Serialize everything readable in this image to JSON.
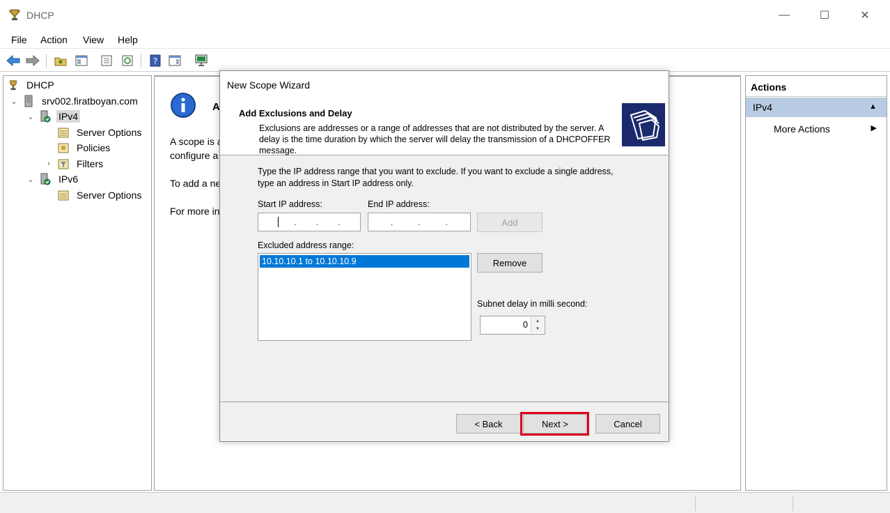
{
  "window": {
    "title": "DHCP",
    "minimize": "—",
    "maximize": "☐",
    "close": "✕"
  },
  "menu": [
    "File",
    "Action",
    "View",
    "Help"
  ],
  "tree": {
    "root": "DHCP",
    "server": "srv002.firatboyan.com",
    "ipv4": "IPv4",
    "ipv4_children": [
      "Server Options",
      "Policies",
      "Filters"
    ],
    "ipv6": "IPv6",
    "ipv6_children": [
      "Server Options"
    ]
  },
  "center": {
    "heading_partial": "A",
    "line1": "A scope is a",
    "line2": "configure a",
    "line3": "To add a ne",
    "line4": "For more in"
  },
  "actions": {
    "header": "Actions",
    "selected": "IPv4",
    "more": "More Actions"
  },
  "wizard": {
    "title": "New Scope Wizard",
    "header_title": "Add Exclusions and Delay",
    "header_desc": "Exclusions are addresses or a range of addresses that are not distributed by the server. A delay is the time duration by which the server will delay the transmission of a DHCPOFFER message.",
    "instructions": "Type the IP address range that you want to exclude. If you want to exclude a single address, type an address in Start IP address only.",
    "start_ip_label": "Start IP address:",
    "end_ip_label": "End IP address:",
    "add_button": "Add",
    "excluded_label": "Excluded address range:",
    "excluded_items": [
      "10.10.10.1 to 10.10.10.9"
    ],
    "remove_button": "Remove",
    "delay_label": "Subnet delay in milli second:",
    "delay_value": "0",
    "back_button": "< Back",
    "next_button": "Next >",
    "cancel_button": "Cancel"
  },
  "colors": {
    "selection_blue": "#0078d7",
    "actions_selected": "#b8cce4",
    "highlight_red": "#e0001b"
  }
}
